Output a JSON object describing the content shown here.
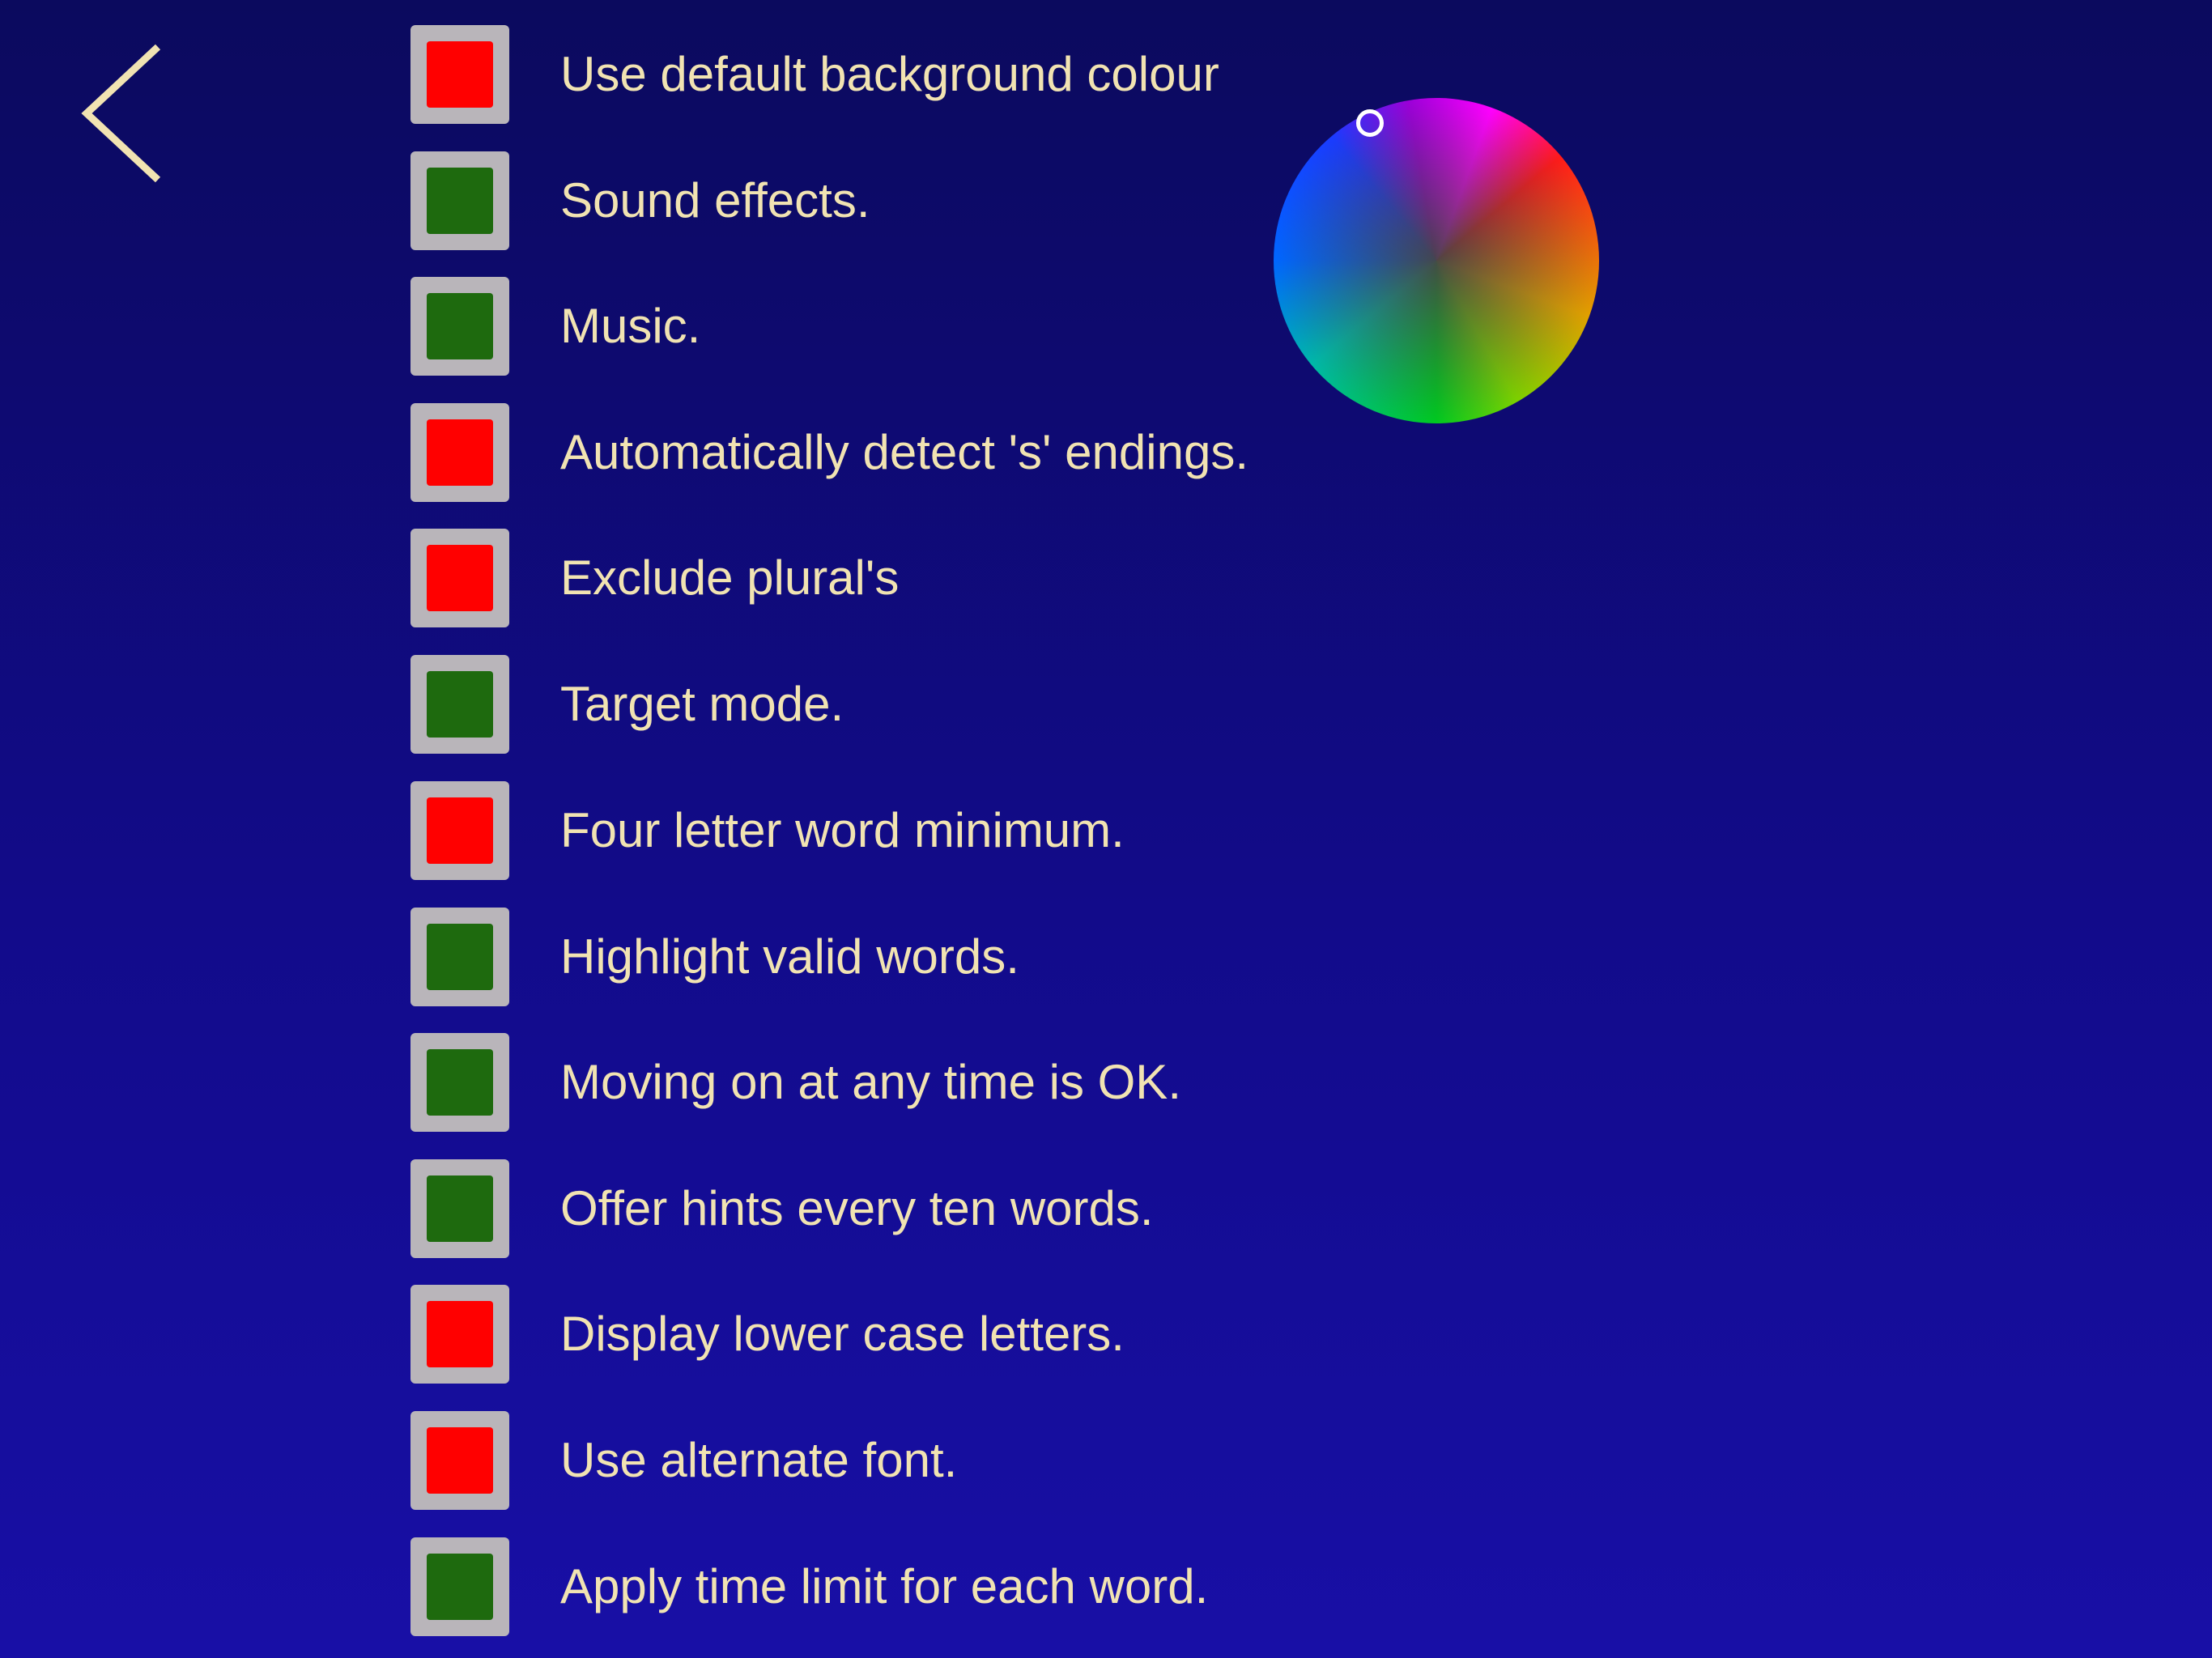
{
  "nav": {
    "back_icon": "chevron-left-icon"
  },
  "colors": {
    "on": "#1e6a0e",
    "off": "#ff0000",
    "label": "#f1e3b2",
    "toggle_frame": "#b9b5ba"
  },
  "settings": [
    {
      "label": "Use default background colour",
      "state": "off"
    },
    {
      "label": "Sound effects.",
      "state": "on"
    },
    {
      "label": "Music.",
      "state": "on"
    },
    {
      "label": "Automatically detect 's' endings.",
      "state": "off"
    },
    {
      "label": "Exclude plural's",
      "state": "off"
    },
    {
      "label": "Target mode.",
      "state": "on"
    },
    {
      "label": "Four letter word minimum.",
      "state": "off"
    },
    {
      "label": "Highlight valid words.",
      "state": "on"
    },
    {
      "label": "Moving on at any time is OK.",
      "state": "on"
    },
    {
      "label": "Offer hints every ten words.",
      "state": "on"
    },
    {
      "label": "Display lower case letters.",
      "state": "off"
    },
    {
      "label": "Use alternate font.",
      "state": "off"
    },
    {
      "label": "Apply time limit for each word.",
      "state": "on"
    }
  ],
  "color_picker": {
    "type": "color-wheel"
  }
}
